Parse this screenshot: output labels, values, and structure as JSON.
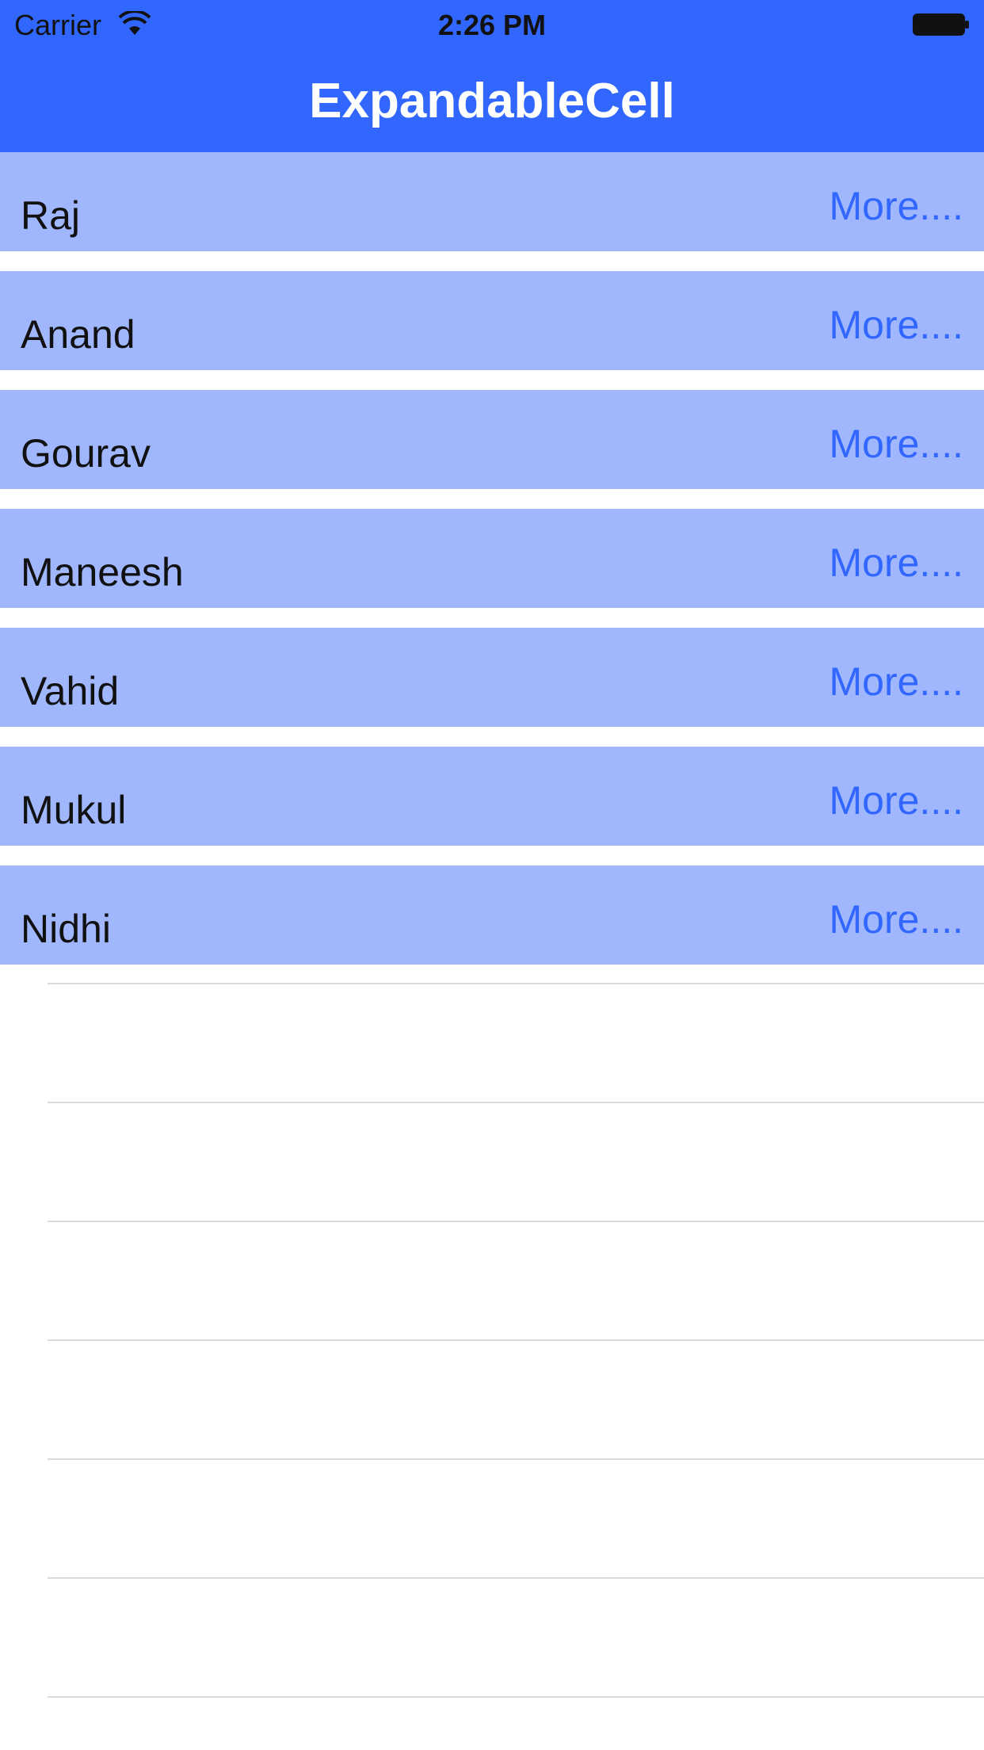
{
  "status_bar": {
    "carrier": "Carrier",
    "time": "2:26 PM"
  },
  "nav": {
    "title": "ExpandableCell"
  },
  "rows": [
    {
      "name": "Raj",
      "more": "More...."
    },
    {
      "name": "Anand",
      "more": "More...."
    },
    {
      "name": "Gourav",
      "more": "More...."
    },
    {
      "name": "Maneesh",
      "more": "More...."
    },
    {
      "name": "Vahid",
      "more": "More...."
    },
    {
      "name": "Mukul",
      "more": "More...."
    },
    {
      "name": "Nidhi",
      "more": "More...."
    }
  ],
  "colors": {
    "nav_background": "#3167FF",
    "row_background": "#A0B6FD",
    "more_text": "#3167FF",
    "separator": "#DADADA"
  }
}
